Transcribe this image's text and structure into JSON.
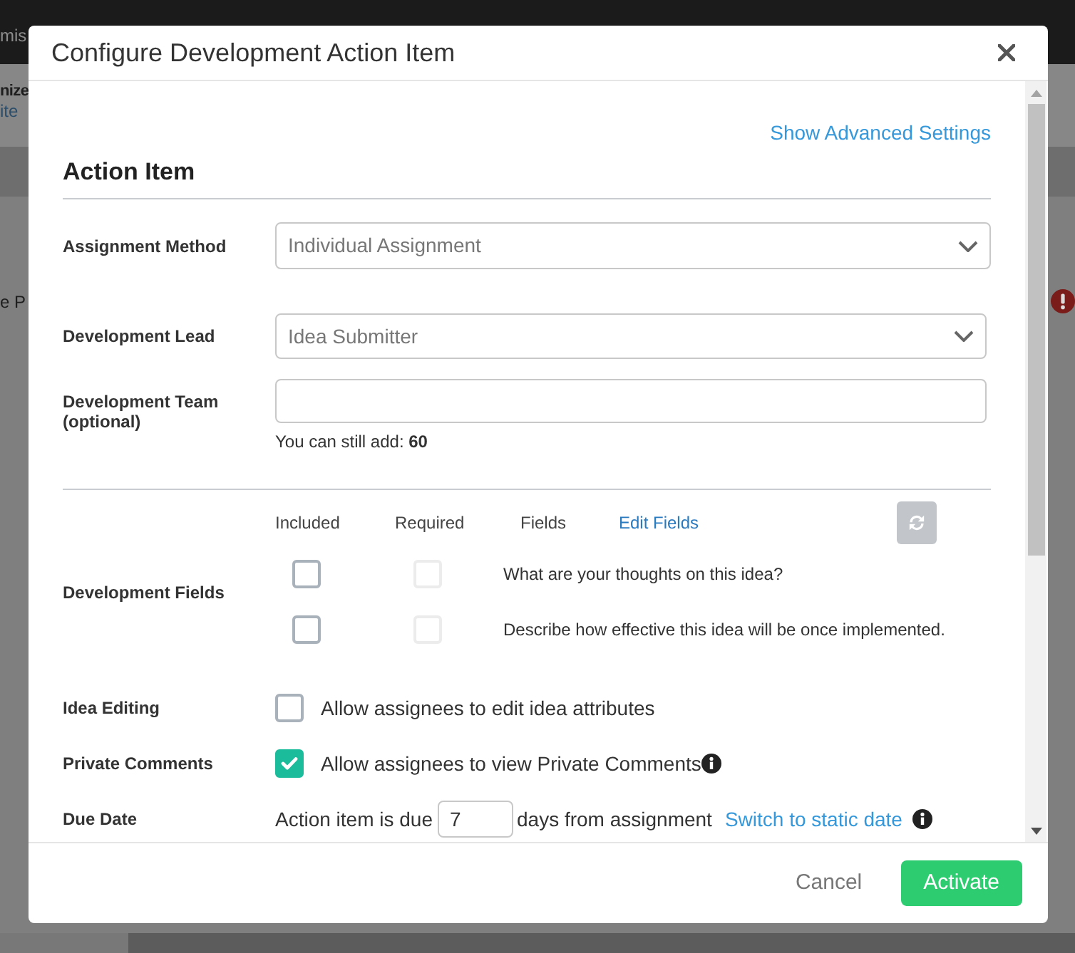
{
  "background": {
    "header_text": "mis",
    "page_title": "nize",
    "page_link": "ite",
    "list_text": "e P"
  },
  "dialog": {
    "title": "Configure Development Action Item"
  },
  "advanced_link": "Show Advanced Settings",
  "section_title": "Action Item",
  "assignment_method": {
    "label": "Assignment Method",
    "value": "Individual Assignment"
  },
  "development_lead": {
    "label": "Development Lead",
    "value": "Idea Submitter"
  },
  "development_team": {
    "label": "Development Team (optional)",
    "hint": "You can still add: **60**"
  },
  "development_fields": {
    "label": "Development Fields",
    "columns": [
      "Included",
      "Required",
      "Fields"
    ],
    "edit_link": "Edit Fields",
    "rows": [
      {
        "included": false,
        "required": false,
        "required_disabled": true,
        "text": "What are your thoughts on this idea?"
      },
      {
        "included": false,
        "required": false,
        "required_disabled": true,
        "text": "Describe how effective this idea will be once implemented."
      }
    ]
  },
  "options": [
    {
      "label": "Idea Editing",
      "text": "Allow assignees to edit idea attributes",
      "checked": false,
      "info": false
    },
    {
      "label": "Private Comments",
      "text": "Allow assignees to view Private Comments",
      "checked": true,
      "info": true
    }
  ],
  "due_date": {
    "label": "Due Date",
    "prefix": "Action item is due",
    "value": "7",
    "suffix": "days from assignment",
    "link": "Switch to static date"
  },
  "footer": {
    "buttons": [
      {
        "label": "Cancel",
        "kind": "secondary"
      },
      {
        "label": "Activate",
        "kind": "primary"
      }
    ]
  }
}
